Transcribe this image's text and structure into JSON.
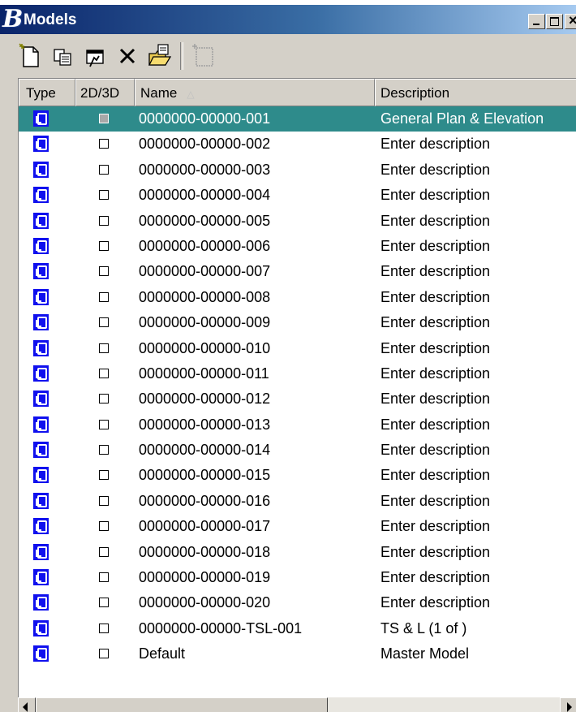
{
  "window": {
    "title": "Models",
    "logo_glyph": "B",
    "controls": [
      "minimize-icon",
      "maximize-icon",
      "close-icon"
    ]
  },
  "toolbar": {
    "buttons": [
      {
        "name": "create-model-button",
        "icon": "new-document-icon"
      },
      {
        "name": "copy-model-button",
        "icon": "copy-icon"
      },
      {
        "name": "properties-button",
        "icon": "properties-icon"
      },
      {
        "name": "delete-button",
        "icon": "delete-icon"
      },
      {
        "name": "import-button",
        "icon": "import-folder-icon"
      },
      {
        "name": "create-sheet-button",
        "icon": "new-sheet-icon",
        "disabled": true
      }
    ]
  },
  "list": {
    "columns": {
      "type": "Type",
      "dim": "2D/3D",
      "name": "Name",
      "desc": "Description"
    },
    "sort": {
      "column": "name",
      "direction": "ascending"
    },
    "selection_color": "#2e8b8b",
    "rows": [
      {
        "name": "0000000-00000-001",
        "desc": "General Plan & Elevation",
        "selected": true
      },
      {
        "name": "0000000-00000-002",
        "desc": "Enter description"
      },
      {
        "name": "0000000-00000-003",
        "desc": "Enter description"
      },
      {
        "name": "0000000-00000-004",
        "desc": "Enter description"
      },
      {
        "name": "0000000-00000-005",
        "desc": "Enter description"
      },
      {
        "name": "0000000-00000-006",
        "desc": "Enter description"
      },
      {
        "name": "0000000-00000-007",
        "desc": "Enter description"
      },
      {
        "name": "0000000-00000-008",
        "desc": "Enter description"
      },
      {
        "name": "0000000-00000-009",
        "desc": "Enter description"
      },
      {
        "name": "0000000-00000-010",
        "desc": "Enter description"
      },
      {
        "name": "0000000-00000-011",
        "desc": "Enter description"
      },
      {
        "name": "0000000-00000-012",
        "desc": "Enter description"
      },
      {
        "name": "0000000-00000-013",
        "desc": "Enter description"
      },
      {
        "name": "0000000-00000-014",
        "desc": "Enter description"
      },
      {
        "name": "0000000-00000-015",
        "desc": "Enter description"
      },
      {
        "name": "0000000-00000-016",
        "desc": "Enter description"
      },
      {
        "name": "0000000-00000-017",
        "desc": "Enter description"
      },
      {
        "name": "0000000-00000-018",
        "desc": "Enter description"
      },
      {
        "name": "0000000-00000-019",
        "desc": "Enter description"
      },
      {
        "name": "0000000-00000-020",
        "desc": "Enter description"
      },
      {
        "name": "0000000-00000-TSL-001",
        "desc": "TS & L (1 of )"
      },
      {
        "name": "Default",
        "desc": "Master Model"
      }
    ]
  }
}
